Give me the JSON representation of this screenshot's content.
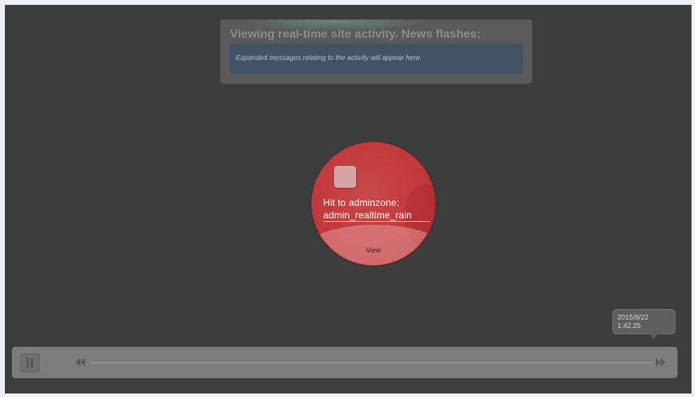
{
  "news": {
    "title": "Viewing real-time site activity. News flashes:",
    "message": "Expanded messages relating to the activity will appear here."
  },
  "bubble": {
    "line1": "Hit to adminzone:",
    "line2": "admin_realtime_rain",
    "view_label": "View",
    "icon": "page-icon",
    "color": "#c0393c"
  },
  "timestamp": {
    "date": "2015/8/22",
    "time": "1:42:25"
  },
  "playback": {
    "pause_icon": "pause-icon",
    "rewind_icon": "rewind-icon",
    "forward_icon": "fast-forward-icon"
  }
}
